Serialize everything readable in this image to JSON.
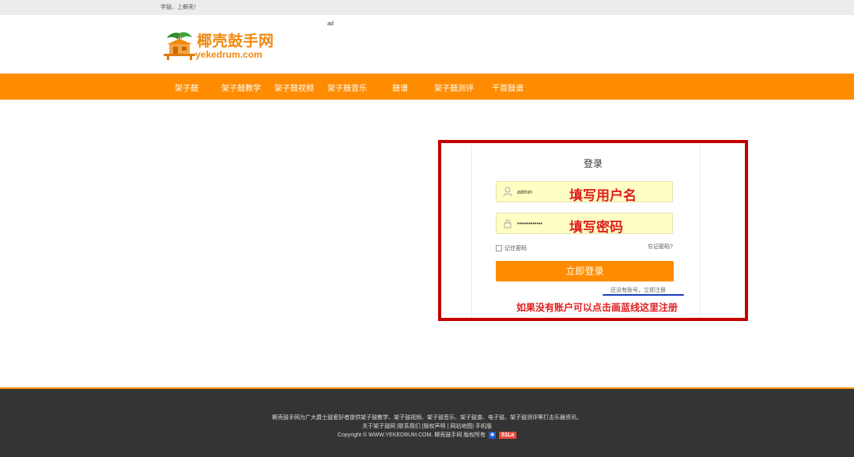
{
  "topbar": {
    "greeting": "学鼓，上椰壳！"
  },
  "header": {
    "logo_cn": "椰壳鼓手网",
    "logo_en": "yekedrum.com",
    "ad": "ad"
  },
  "nav": {
    "items": [
      "架子鼓",
      "架子鼓教学",
      "架子鼓视频",
      "架子鼓音乐",
      "鼓谱",
      "架子鼓测评",
      "千首鼓谱"
    ]
  },
  "login": {
    "title": "登录",
    "username_value": "admin",
    "password_value": "•••••••••••••",
    "username_annotation": "填写用户名",
    "password_annotation": "填写密码",
    "remember_label": "记住密码",
    "forgot_label": "忘记密码?",
    "submit_label": "立即登录",
    "register_link": "还没有账号，立即注册",
    "register_note": "如果没有账户可以点击画蓝线这里注册"
  },
  "footer": {
    "description": "椰壳鼓手网为广大爵士鼓爱好者提供架子鼓教学、架子鼓视频、架子鼓音乐、架子鼓谱、电子鼓、架子鼓测评等打击乐器资讯。",
    "links": "关于架子鼓网 |联系我们 |版权声明 | 网站地图| 手机版",
    "copyright": "Copyright © WWW.YEKEDRUM.COM. 椰壳鼓手网 版权所有",
    "badge_51la": "51La"
  },
  "colors": {
    "accent": "#ff8c00",
    "frame": "#c40000",
    "annotation": "#e02020",
    "underline": "#1a3fb8",
    "field_bg": "#ffffc4"
  }
}
